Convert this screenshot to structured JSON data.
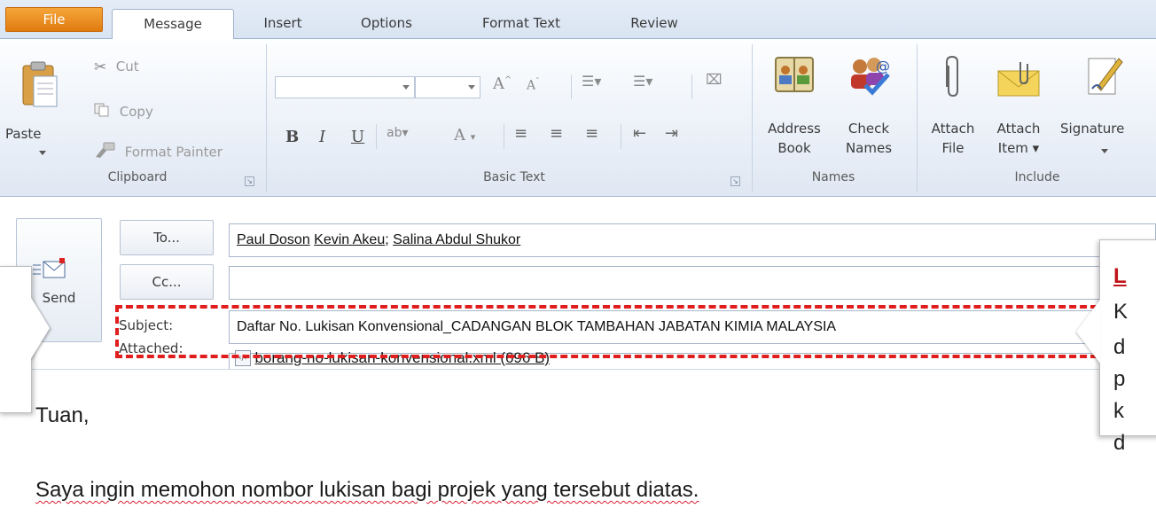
{
  "tabs": [
    "File",
    "Message",
    "Insert",
    "Options",
    "Format Text",
    "Review"
  ],
  "clipboard": {
    "paste_label": "Paste",
    "cut_label": "Cut",
    "copy_label": "Copy",
    "format_painter_label": "Format Painter",
    "group_label": "Clipboard"
  },
  "basic_text": {
    "group_label": "Basic Text",
    "bold": "B",
    "italic": "I",
    "underline": "U",
    "grow_font": "A",
    "shrink_font": "A",
    "font_color": "A"
  },
  "names": {
    "address_book_line1": "Address",
    "address_book_line2": "Book",
    "check_names_line1": "Check",
    "check_names_line2": "Names",
    "group_label": "Names"
  },
  "include": {
    "attach_file_line1": "Attach",
    "attach_file_line2": "File",
    "attach_item_line1": "Attach",
    "attach_item_line2": "Item ▾",
    "signature_label": "Signature",
    "group_label": "Include"
  },
  "send": {
    "label": "Send"
  },
  "header": {
    "to_button": "To...",
    "cc_button": "Cc...",
    "subject_label": "Subject:",
    "attached_label": "Attached:",
    "to_recipients": [
      "Paul Doson",
      "Kevin Akeu",
      "Salina Abdul Shukor"
    ],
    "cc_value": "",
    "subject_value": "Daftar No. Lukisan Konvensional_CADANGAN BLOK TAMBAHAN JABATAN KIMIA MALAYSIA",
    "attachment_name": "borang-no-lukisan-konvensional.xml (696 B)"
  },
  "body": {
    "greeting": "Tuan,",
    "line1": "Saya ingin memohon nombor lukisan bagi projek yang tersebut diatas."
  },
  "callout_right": {
    "heading": "L",
    "lines": [
      "K",
      "d",
      "p",
      "k",
      "d"
    ]
  },
  "colors": {
    "accent_orange": "#e07b10",
    "highlight_red": "#e01e1e",
    "ribbon_blue": "#dfe7f2"
  }
}
